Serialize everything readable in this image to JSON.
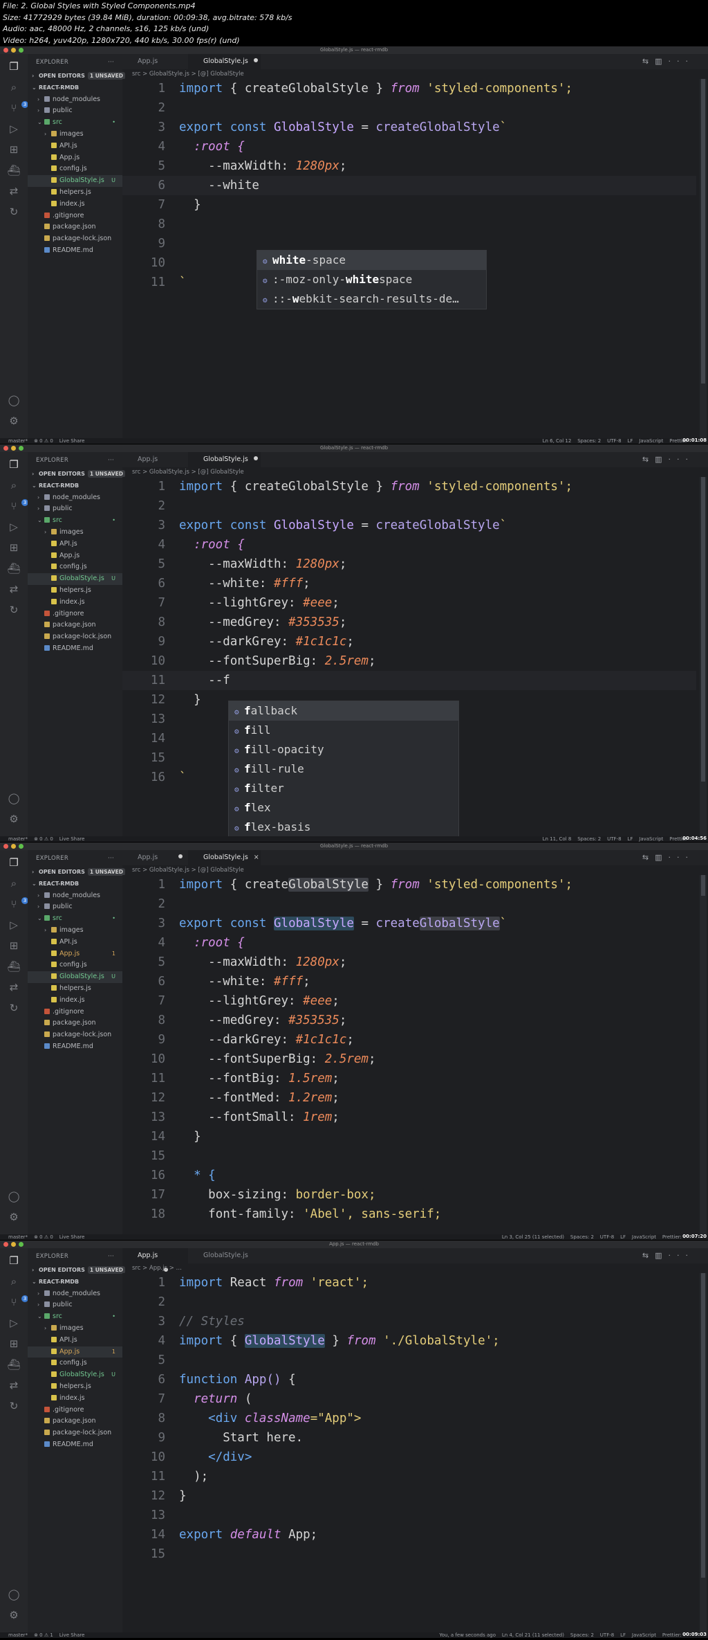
{
  "meta": {
    "line1": "File: 2. Global Styles with Styled Components.mp4",
    "line2": "Size: 41772929 bytes (39.84 MiB), duration: 00:09:38, avg.bitrate: 578 kb/s",
    "line3": "Audio: aac, 48000 Hz, 2 channels, s16, 125 kb/s (und)",
    "line4": "Video: h264, yuv420p, 1280x720, 440 kb/s, 30.00 fps(r) (und)"
  },
  "explorer": {
    "title": "EXPLORER",
    "open_editors": "OPEN EDITORS",
    "unsaved": "1 UNSAVED",
    "project": "REACT-RMDB",
    "files": {
      "node_modules": "node_modules",
      "public": "public",
      "src": "src",
      "images": "images",
      "api": "API.js",
      "app": "App.js",
      "config": "config.js",
      "globalstyle": "GlobalStyle.js",
      "helpers": "helpers.js",
      "index": "index.js",
      "gitignore": ".gitignore",
      "package": "package.json",
      "packagelock": "package-lock.json",
      "readme": "README.md"
    },
    "tag_u": "U",
    "tag_1": "1"
  },
  "frames": [
    {
      "title": "GlobalStyle.js — react-rmdb",
      "tab_app": "App.js",
      "tab_global": "GlobalStyle.js",
      "crumb": "src  >  GlobalStyle.js  >  [@] GlobalStyle",
      "status_left": "master*    ⊗ 0 ⚠ 0    Live Share",
      "status_right": "Ln 6, Col 12    Spaces: 2    UTF-8    LF    JavaScript    Prettier",
      "timestamp": "00:01:08",
      "suggestions": [
        {
          "bold": "white",
          "rest": "-space"
        },
        {
          "pre": ":-moz-only-",
          "bold": "white",
          "rest": "space"
        },
        {
          "pre": "::-",
          "bold": "w",
          "rest": "ebkit-search-results-de…"
        }
      ]
    },
    {
      "title": "GlobalStyle.js — react-rmdb",
      "tab_app": "App.js",
      "tab_global": "GlobalStyle.js",
      "crumb": "src  >  GlobalStyle.js  >  [@] GlobalStyle",
      "status_left": "master*    ⊗ 0 ⚠ 0    Live Share",
      "status_right": "Ln 11, Col 8    Spaces: 2    UTF-8    LF    JavaScript    Prettier",
      "timestamp": "00:04:56",
      "suggestions": [
        {
          "bold": "f",
          "rest": "allback"
        },
        {
          "bold": "f",
          "rest": "ill"
        },
        {
          "bold": "f",
          "rest": "ill-opacity"
        },
        {
          "bold": "f",
          "rest": "ill-rule"
        },
        {
          "bold": "f",
          "rest": "ilter"
        },
        {
          "bold": "f",
          "rest": "lex"
        },
        {
          "bold": "f",
          "rest": "lex-basis"
        }
      ]
    },
    {
      "title": "GlobalStyle.js — react-rmdb",
      "tab_app": "App.js",
      "tab_global": "GlobalStyle.js",
      "crumb": "src  >  GlobalStyle.js  >  [@] GlobalStyle",
      "status_left": "master*    ⊗ 0 ⚠ 0    Live Share",
      "status_right": "Ln 3, Col 25 (11 selected)    Spaces: 2    UTF-8    LF    JavaScript    Prettier: ✓",
      "timestamp": "00:07:20"
    },
    {
      "title": "App.js — react-rmdb",
      "tab_app": "App.js",
      "tab_global": "GlobalStyle.js",
      "crumb": "src  >  App.js  >  …",
      "status_left": "master*    ⊗ 0 ⚠ 1    Live Share",
      "status_right": "You, a few seconds ago    Ln 4, Col 21 (11 selected)    Spaces: 2    UTF-8    LF    JavaScript    Prettier: ✓",
      "timestamp": "00:09:03"
    }
  ],
  "code": {
    "import_kw": "import",
    "create": "{ createGlobalStyle }",
    "from": "from",
    "sc": "'styled-components';",
    "export": "export",
    "const": "const",
    "GlobalStyle": "GlobalStyle",
    "eq": "=",
    "createGS": "createGlobalStyle",
    "bt": "`",
    "root": ":root {",
    "maxw": "--maxWidth:",
    "maxw_v": "1280px",
    "white1": "--white",
    "white": "--white:",
    "white_v": "#fff",
    "light": "--lightGrey:",
    "light_v": "#eee",
    "med": "--medGrey:",
    "med_v": "#353535",
    "dark": "--darkGrey:",
    "dark_v": "#1c1c1c",
    "fsb": "--fontSuperBig:",
    "fsb_v": "2.5rem",
    "ff": "--f",
    "fb": "--fontBig:",
    "fb_v": "1.5rem",
    "fm": "--fontMed:",
    "fm_v": "1.2rem",
    "fs": "--fontSmall:",
    "fs_v": "1rem",
    "close": "}",
    "star": "* {",
    "boxsizing": "box-sizing:",
    "boxsizing_v": "border-box;",
    "fontfam": "font-family:",
    "fontfam_v": "'Abel', sans-serif;",
    "semi": ";",
    "react": "React",
    "react_str": "'react';",
    "comment": "// Styles",
    "lbrace": "{",
    "rbrace": "}",
    "gs_path": "'./GlobalStyle';",
    "function": "function",
    "App": "App()",
    "return": "return",
    "paren": "(",
    "div_open": "<div",
    "classname": "className",
    "app_str": "=\"App\">",
    "start_here": "Start here.",
    "div_close": "</div>",
    "close_paren": ");",
    "default": "default",
    "app_semi": "App;"
  }
}
